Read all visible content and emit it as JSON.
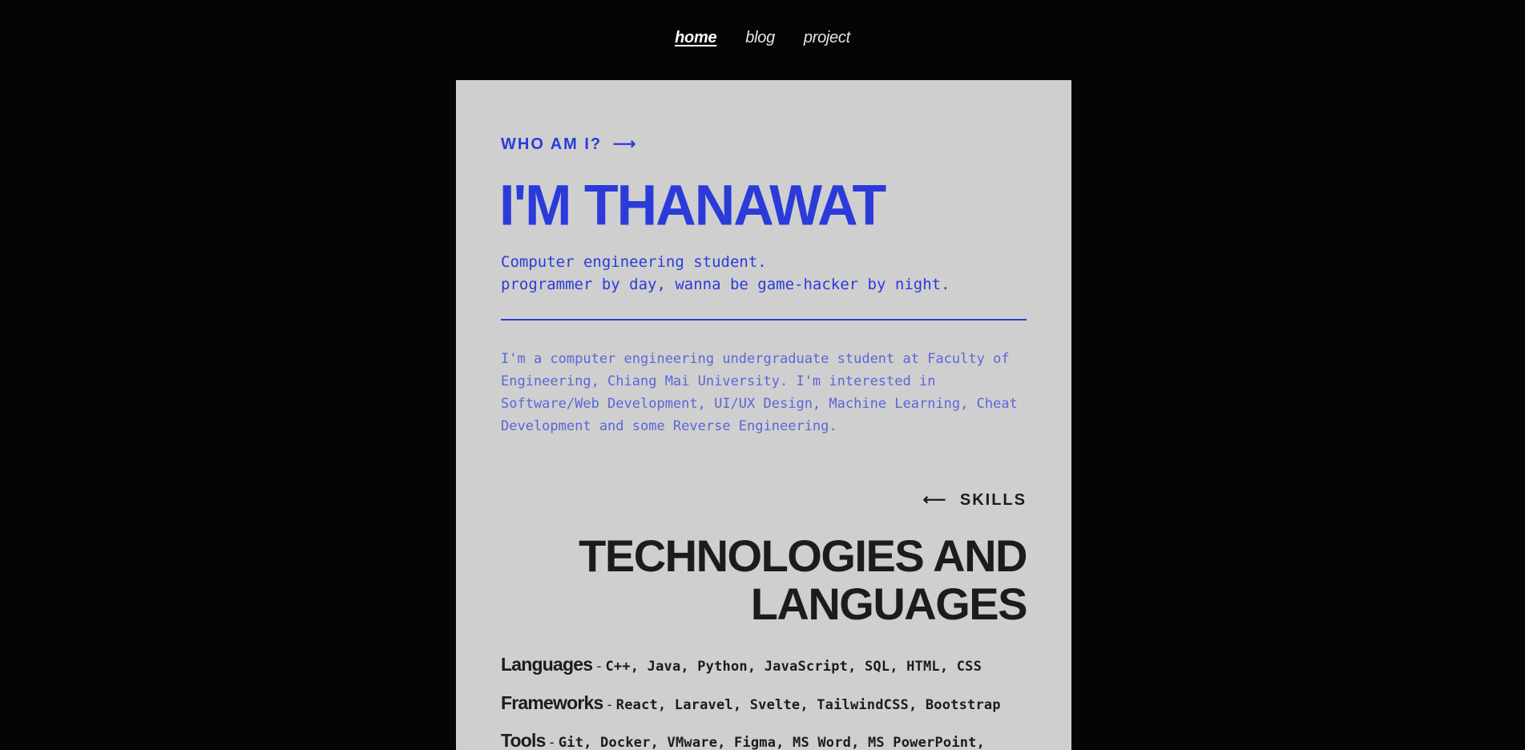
{
  "nav": {
    "items": [
      {
        "label": "home",
        "active": true
      },
      {
        "label": "blog",
        "active": false
      },
      {
        "label": "project",
        "active": false
      }
    ]
  },
  "intro": {
    "eyebrow": "WHO AM I?",
    "eyebrow_arrow": "⟶",
    "title": "I'M THANAWAT",
    "tagline_line1": "Computer engineering student.",
    "tagline_line2": "programmer by day, wanna be game-hacker by night.",
    "bio": "I'm a computer engineering undergraduate student at Faculty of Engineering, Chiang Mai University. I'm interested in Software/Web Development, UI/UX Design, Machine Learning, Cheat Development and some Reverse Engineering."
  },
  "skills": {
    "eyebrow_arrow": "⟵",
    "eyebrow": "SKILLS",
    "title_line1": "TECHNOLOGIES AND",
    "title_line2": "LANGUAGES",
    "rows": [
      {
        "label": "Languages",
        "items": "C++, Java, Python, JavaScript, SQL, HTML, CSS"
      },
      {
        "label": "Frameworks",
        "items": "React, Laravel, Svelte, TailwindCSS, Bootstrap"
      },
      {
        "label": "Tools",
        "items": "Git, Docker, VMware, Figma, MS Word, MS PowerPoint,"
      }
    ]
  },
  "colors": {
    "background": "#050505",
    "card": "#cfcfcf",
    "accent_blue": "#2b3bd9",
    "text_dark": "#1c1c1c"
  }
}
